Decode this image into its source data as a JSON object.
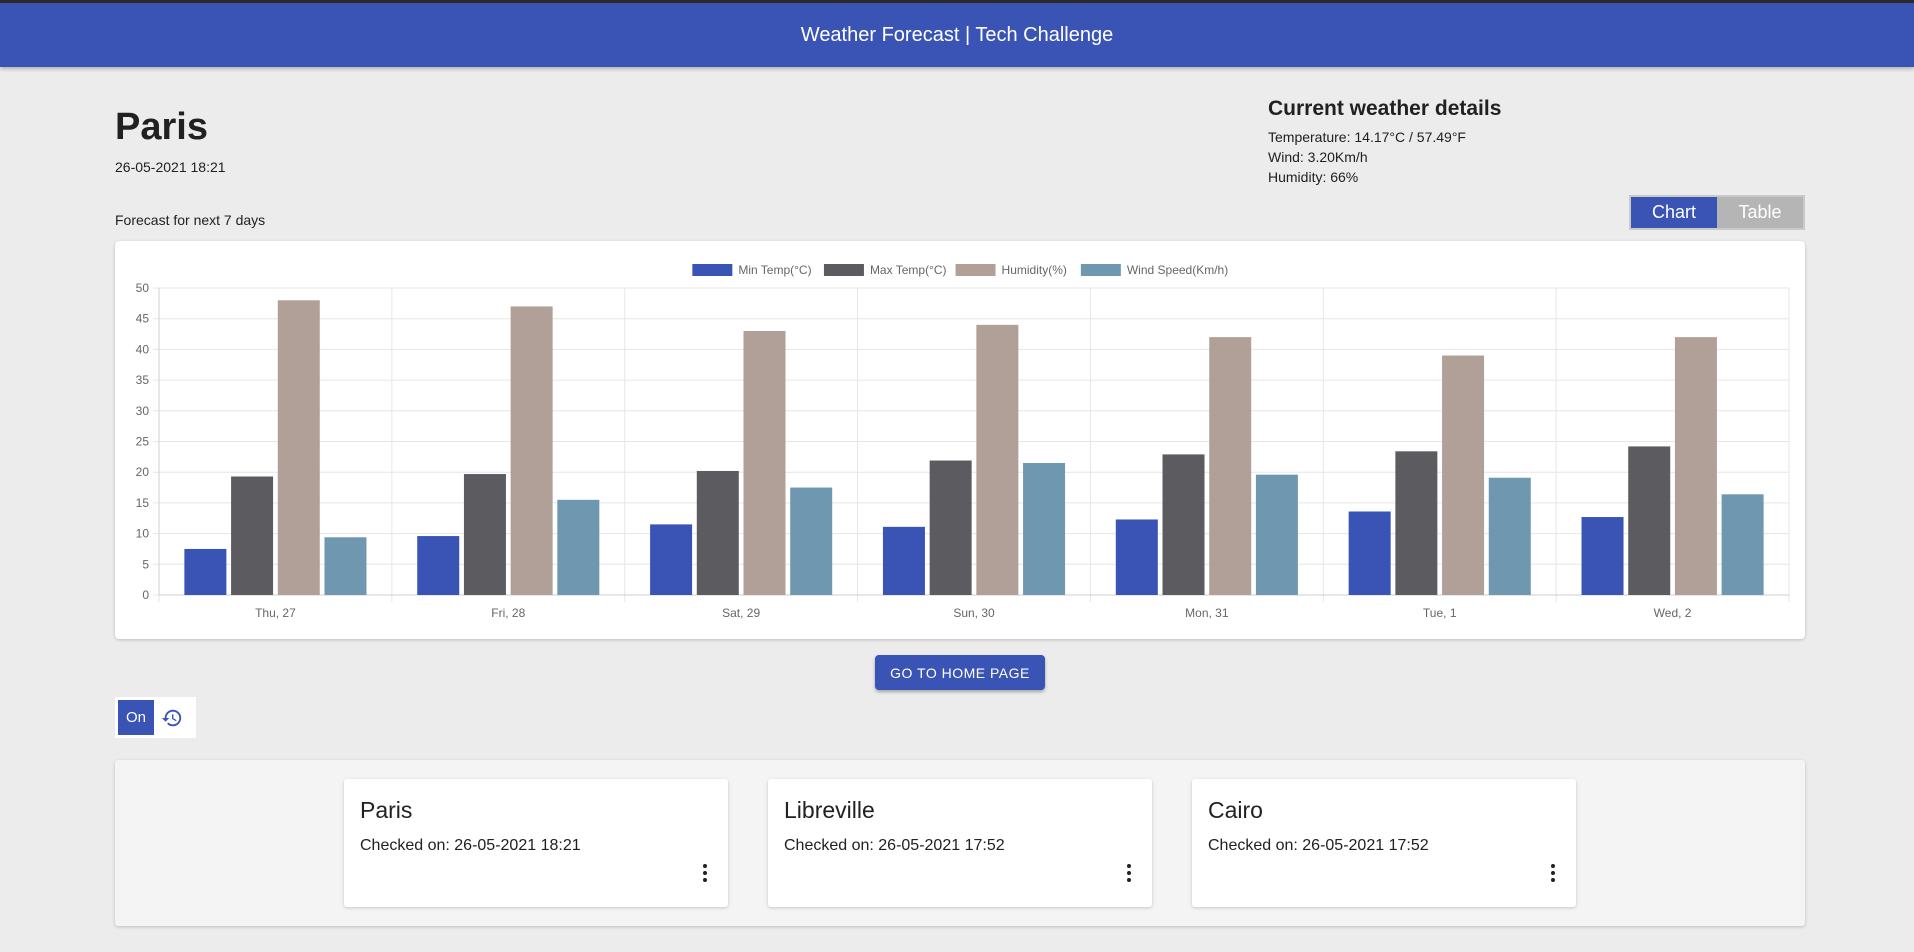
{
  "header": {
    "title": "Weather Forecast | Tech Challenge"
  },
  "city": {
    "name": "Paris",
    "datetime": "26-05-2021 18:21"
  },
  "current": {
    "heading": "Current weather details",
    "temperature": "Temperature: 14.17°C / 57.49°F",
    "wind": "Wind: 3.20Km/h",
    "humidity": "Humidity: 66%"
  },
  "forecast_label": "Forecast for next 7 days",
  "view_toggle": {
    "chart_label": "Chart",
    "table_label": "Table",
    "selected": "Chart"
  },
  "chart_data": {
    "type": "bar",
    "categories": [
      "Thu, 27",
      "Fri, 28",
      "Sat, 29",
      "Sun, 30",
      "Mon, 31",
      "Tue, 1",
      "Wed, 2"
    ],
    "series": [
      {
        "name": "Min Temp(°C)",
        "color": "#3a54b5",
        "values": [
          7.5,
          9.6,
          11.5,
          11.1,
          12.3,
          13.6,
          12.7
        ]
      },
      {
        "name": "Max Temp(°C)",
        "color": "#5c5c60",
        "values": [
          19.3,
          19.7,
          20.2,
          21.9,
          22.9,
          23.4,
          24.2
        ]
      },
      {
        "name": "Humidity(%)",
        "color": "#b1a097",
        "values": [
          48,
          47,
          43,
          44,
          42,
          39,
          42
        ]
      },
      {
        "name": "Wind Speed(Km/h)",
        "color": "#6f98b0",
        "values": [
          9.4,
          15.5,
          17.5,
          21.5,
          19.6,
          19.1,
          16.4
        ]
      }
    ],
    "ylim": [
      0,
      50
    ],
    "yticks": [
      0,
      5,
      10,
      15,
      20,
      25,
      30,
      35,
      40,
      45,
      50
    ],
    "grid": true,
    "legend": "top-center"
  },
  "home_button": {
    "label": "GO TO HOME PAGE"
  },
  "history_toggle": {
    "on_label": "On",
    "icon": "history-icon"
  },
  "history": [
    {
      "city": "Paris",
      "checked": "Checked on: 26-05-2021 18:21"
    },
    {
      "city": "Libreville",
      "checked": "Checked on: 26-05-2021 17:52"
    },
    {
      "city": "Cairo",
      "checked": "Checked on: 26-05-2021 17:52"
    }
  ]
}
